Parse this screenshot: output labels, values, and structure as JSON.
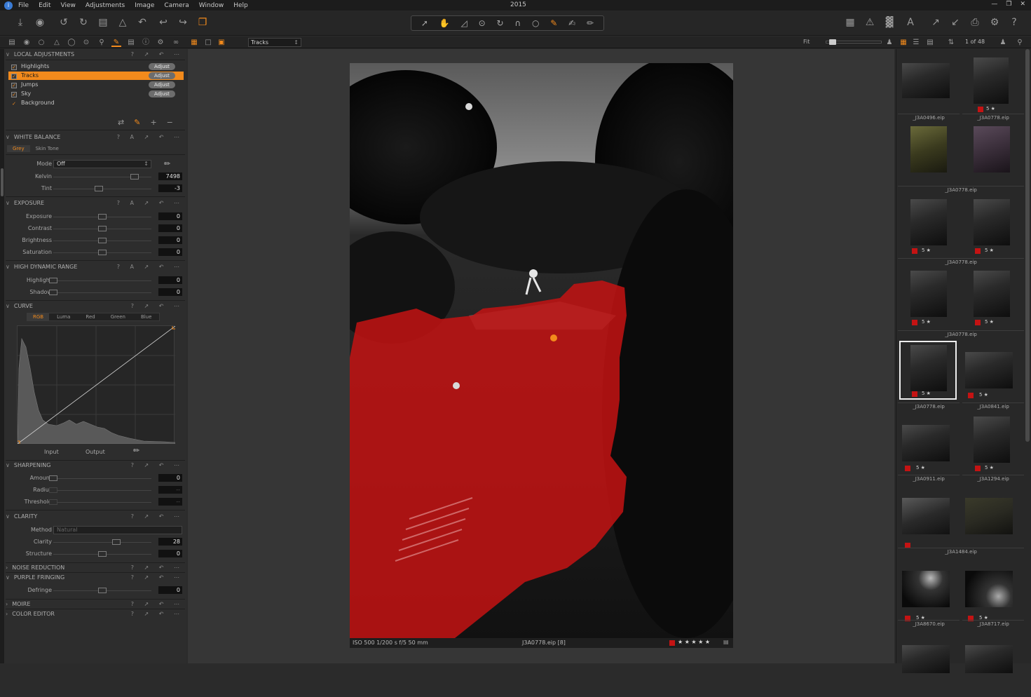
{
  "app": {
    "window_title": "2015",
    "menu": [
      "File",
      "Edit",
      "View",
      "Adjustments",
      "Image",
      "Camera",
      "Window",
      "Help"
    ],
    "accent_color": "#f28a1c",
    "mask_color": "#c41313"
  },
  "toolbar": {
    "variant_select": "Tracks",
    "fit_label": "Fit",
    "page_count": "1 of 48"
  },
  "local_adjustments": {
    "title": "LOCAL ADJUSTMENTS",
    "layers": [
      {
        "name": "Highlights",
        "button": "Adjust"
      },
      {
        "name": "Tracks",
        "button": "Adjust"
      },
      {
        "name": "Jumps",
        "button": "Adjust"
      },
      {
        "name": "Sky",
        "button": "Adjust"
      },
      {
        "name": "Background",
        "button": ""
      }
    ]
  },
  "white_balance": {
    "title": "WHITE BALANCE",
    "tabs": [
      "Grey",
      "Skin Tone"
    ],
    "mode_label": "Mode",
    "mode_value": "Off",
    "kelvin_label": "Kelvin",
    "kelvin_value": "7498",
    "tint_label": "Tint",
    "tint_value": "-3"
  },
  "exposure": {
    "title": "EXPOSURE",
    "rows": [
      {
        "label": "Exposure",
        "value": "0"
      },
      {
        "label": "Contrast",
        "value": "0"
      },
      {
        "label": "Brightness",
        "value": "0"
      },
      {
        "label": "Saturation",
        "value": "0"
      }
    ]
  },
  "hdr": {
    "title": "HIGH DYNAMIC RANGE",
    "rows": [
      {
        "label": "Highlight",
        "value": "0"
      },
      {
        "label": "Shadow",
        "value": "0"
      }
    ]
  },
  "curve": {
    "title": "CURVE",
    "tabs": [
      "RGB",
      "Luma",
      "Red",
      "Green",
      "Blue"
    ],
    "input_label": "Input",
    "output_label": "Output"
  },
  "sharpening": {
    "title": "SHARPENING",
    "rows": [
      {
        "label": "Amount",
        "value": "0"
      },
      {
        "label": "Radius",
        "value": "--"
      },
      {
        "label": "Threshold",
        "value": "--"
      }
    ]
  },
  "clarity": {
    "title": "CLARITY",
    "method_label": "Method",
    "method_value": "Natural",
    "rows": [
      {
        "label": "Clarity",
        "value": "28"
      },
      {
        "label": "Structure",
        "value": "0"
      }
    ]
  },
  "collapsed_tools": {
    "noise_reduction": "NOISE REDUCTION",
    "purple_fringing": "PURPLE FRINGING",
    "defringe_label": "Defringe",
    "defringe_value": "0",
    "moire": "MOIRE",
    "color_editor": "COLOR EDITOR"
  },
  "viewer": {
    "exif": "ISO 500  1/200 s  f/5  50 mm",
    "filename": "J3A0778.eip [8]",
    "rating_stars": "★ ★ ★ ★ ★"
  },
  "browser": {
    "thumbs": [
      {
        "name": "_J3A0496.eip",
        "stars": ""
      },
      {
        "name": "_J3A0778.eip",
        "stars": "5 ★"
      },
      {
        "name": "_J3A0778.eip",
        "stars": ""
      },
      {
        "name": "_J3A0778.eip",
        "stars": "5 ★"
      },
      {
        "name": "_J3A0778.eip",
        "stars": "5 ★"
      },
      {
        "name": "_J3A0778.eip",
        "stars": "5 ★"
      },
      {
        "name": "_J3A0841.eip",
        "stars": "5 ★"
      },
      {
        "name": "_J3A0911.eip",
        "stars": "5 ★"
      },
      {
        "name": "_J3A1294.eip",
        "stars": "5 ★"
      },
      {
        "name": "_J3A1484.eip",
        "stars": ""
      },
      {
        "name": "_J3A8670.eip",
        "stars": "5 ★"
      },
      {
        "name": "_J3A8717.eip",
        "stars": "5 ★"
      }
    ]
  }
}
